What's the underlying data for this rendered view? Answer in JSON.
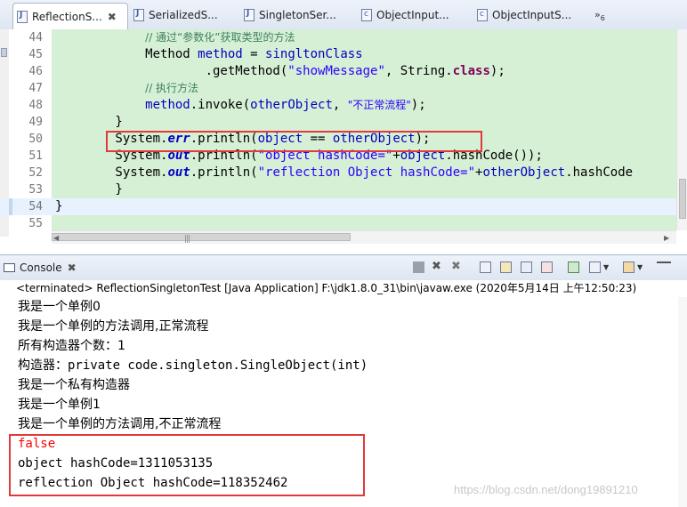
{
  "editor_tabs": [
    {
      "label": "ReflectionS...",
      "close": "✖"
    },
    {
      "label": "SerializedS..."
    },
    {
      "label": "SingletonSer..."
    },
    {
      "label": "ObjectInput..."
    },
    {
      "label": "ObjectInputS..."
    }
  ],
  "tab_overflow": {
    "symbol": "»",
    "count": "6"
  },
  "code_lines": [
    {
      "no": "44",
      "parts": [
        {
          "t": "            ",
          "c": ""
        },
        {
          "t": "// 通过“参数化”获取类型的方法",
          "c": "cmt"
        }
      ]
    },
    {
      "no": "45",
      "parts": [
        {
          "t": "            Method ",
          "c": ""
        },
        {
          "t": "method",
          "c": "fld"
        },
        {
          "t": " = ",
          "c": ""
        },
        {
          "t": "singltonClass",
          "c": "fld"
        }
      ]
    },
    {
      "no": "46",
      "parts": [
        {
          "t": "                    .getMethod(",
          "c": ""
        },
        {
          "t": "\"showMessage\"",
          "c": "str"
        },
        {
          "t": ", String.",
          "c": ""
        },
        {
          "t": "class",
          "c": "kw"
        },
        {
          "t": ");",
          "c": ""
        }
      ]
    },
    {
      "no": "47",
      "parts": [
        {
          "t": "            ",
          "c": ""
        },
        {
          "t": "// 执行方法",
          "c": "cmt"
        }
      ]
    },
    {
      "no": "48",
      "parts": [
        {
          "t": "            ",
          "c": ""
        },
        {
          "t": "method",
          "c": "fld"
        },
        {
          "t": ".invoke(",
          "c": ""
        },
        {
          "t": "otherObject",
          "c": "fld"
        },
        {
          "t": ", ",
          "c": ""
        },
        {
          "t": "\"不正常流程\"",
          "c": "strcn"
        },
        {
          "t": ");",
          "c": ""
        }
      ]
    },
    {
      "no": "49",
      "parts": [
        {
          "t": "        }",
          "c": ""
        }
      ]
    },
    {
      "no": "50",
      "parts": [
        {
          "t": "        System.",
          "c": ""
        },
        {
          "t": "err",
          "c": "sfld"
        },
        {
          "t": ".println(",
          "c": ""
        },
        {
          "t": "object",
          "c": "fld"
        },
        {
          "t": " == ",
          "c": ""
        },
        {
          "t": "otherObject",
          "c": "fld"
        },
        {
          "t": ");",
          "c": ""
        }
      ]
    },
    {
      "no": "51",
      "parts": [
        {
          "t": "        System.",
          "c": ""
        },
        {
          "t": "out",
          "c": "sfld"
        },
        {
          "t": ".println(",
          "c": ""
        },
        {
          "t": "\"object hashCode=\"",
          "c": "str"
        },
        {
          "t": "+",
          "c": ""
        },
        {
          "t": "object",
          "c": "fld"
        },
        {
          "t": ".hashCode());",
          "c": ""
        }
      ]
    },
    {
      "no": "52",
      "parts": [
        {
          "t": "        System.",
          "c": ""
        },
        {
          "t": "out",
          "c": "sfld"
        },
        {
          "t": ".println(",
          "c": ""
        },
        {
          "t": "\"reflection Object hashCode=\"",
          "c": "str"
        },
        {
          "t": "+",
          "c": ""
        },
        {
          "t": "otherObject",
          "c": "fld"
        },
        {
          "t": ".hashCode",
          "c": ""
        }
      ]
    },
    {
      "no": "53",
      "parts": [
        {
          "t": "        }",
          "c": ""
        }
      ]
    },
    {
      "no": "54",
      "parts": [
        {
          "t": "}",
          "c": ""
        }
      ]
    },
    {
      "no": "55",
      "parts": []
    }
  ],
  "console": {
    "tab_label": "Console",
    "close": "✖",
    "terminated": "<terminated> ReflectionSingletonTest [Java Application] F:\\jdk1.8.0_31\\bin\\javaw.exe (2020年5月14日 上午12:50:23)",
    "output": [
      {
        "text": "我是一个单例0",
        "kind": "out"
      },
      {
        "text": "我是一个单例的方法调用,正常流程",
        "kind": "out"
      },
      {
        "text": "所有构造器个数：1",
        "kind": "out"
      },
      {
        "text": "构造器：private code.singleton.SingleObject(int)",
        "kind": "out"
      },
      {
        "text": "我是一个私有构造器",
        "kind": "out"
      },
      {
        "text": "我是一个单例1",
        "kind": "out"
      },
      {
        "text": "我是一个单例的方法调用,不正常流程",
        "kind": "out"
      },
      {
        "text": "false",
        "kind": "err"
      },
      {
        "text": "object hashCode=1311053135",
        "kind": "out"
      },
      {
        "text": "reflection Object hashCode=118352462",
        "kind": "out"
      }
    ]
  },
  "watermark": "https://blog.csdn.net/dong19891210",
  "colors": {
    "highlight_box": "#e03a3a",
    "code_background": "#d6f0d6",
    "stderr_text": "#ff0000",
    "comment": "#3f7f5f",
    "keyword": "#7f0055",
    "string": "#2a00ff",
    "field": "#0000c0"
  },
  "icons": [
    "java-file-icon",
    "class-file-icon",
    "console-monitor-icon",
    "terminate-icon",
    "remove-launch-icon",
    "clear-console-icon",
    "scroll-lock-icon",
    "pin-console-icon",
    "open-console-icon"
  ]
}
